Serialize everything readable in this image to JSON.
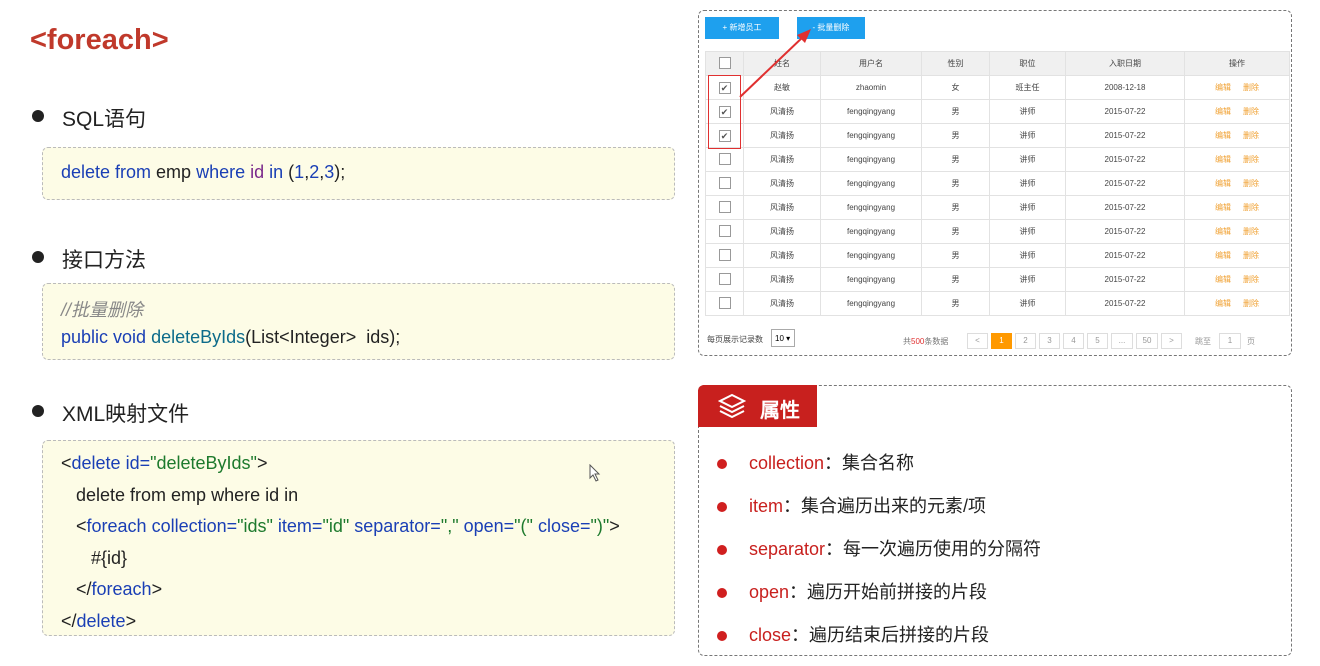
{
  "title": "<foreach>",
  "sections": [
    {
      "heading": "SQL语句",
      "lines": [
        [
          [
            "delete from",
            "kw"
          ],
          [
            " emp ",
            ""
          ],
          [
            "where",
            "kw"
          ],
          [
            " ",
            ""
          ],
          [
            "id",
            "pur"
          ],
          [
            " ",
            ""
          ],
          [
            "in",
            "kw"
          ],
          [
            " (",
            ""
          ],
          [
            "1",
            "num"
          ],
          [
            ",",
            ""
          ],
          [
            "2",
            "num"
          ],
          [
            ",",
            ""
          ],
          [
            "3",
            "num"
          ],
          [
            ");",
            ""
          ]
        ]
      ]
    },
    {
      "heading": "接口方法",
      "lines": [
        [
          [
            "//批量删除",
            "cmt"
          ]
        ],
        [
          [
            "public void",
            "kw"
          ],
          [
            " ",
            ""
          ],
          [
            "deleteByIds",
            "fn"
          ],
          [
            "(List<Integer>  ids);",
            ""
          ]
        ]
      ]
    },
    {
      "heading": "XML映射文件",
      "lines": [
        [
          [
            "<",
            ""
          ],
          [
            "delete",
            "kw"
          ],
          [
            " id=",
            "kw"
          ],
          [
            "\"deleteByIds\"",
            "str"
          ],
          [
            ">",
            ""
          ]
        ],
        [
          [
            "   delete from emp where id in",
            ""
          ]
        ],
        [
          [
            "   <",
            ""
          ],
          [
            "foreach",
            "kw"
          ],
          [
            " collection=",
            "kw"
          ],
          [
            "\"ids\"",
            "str"
          ],
          [
            " item=",
            "kw"
          ],
          [
            "\"id\"",
            "str"
          ],
          [
            " separator=",
            "kw"
          ],
          [
            "\",\"",
            "str"
          ],
          [
            " open=",
            "kw"
          ],
          [
            "\"(\"",
            "str"
          ],
          [
            " close=",
            "kw"
          ],
          [
            "\")\"",
            "str"
          ],
          [
            ">",
            ""
          ]
        ],
        [
          [
            "      #{id}",
            ""
          ]
        ],
        [
          [
            "   </",
            ""
          ],
          [
            "foreach",
            "kw"
          ],
          [
            ">",
            ""
          ]
        ],
        [
          [
            "</",
            ""
          ],
          [
            "delete",
            "kw"
          ],
          [
            ">",
            ""
          ]
        ]
      ]
    }
  ],
  "widget": {
    "add_button": "+ 新增员工",
    "batch_delete_button": "- 批量删除",
    "columns": [
      "姓名",
      "用户名",
      "性别",
      "职位",
      "入职日期",
      "操作"
    ],
    "rows": [
      {
        "checked": true,
        "name": "赵敏",
        "username": "zhaomin",
        "gender": "女",
        "position": "班主任",
        "date": "2008-12-18"
      },
      {
        "checked": true,
        "name": "风清扬",
        "username": "fengqingyang",
        "gender": "男",
        "position": "讲师",
        "date": "2015-07-22"
      },
      {
        "checked": true,
        "name": "风清扬",
        "username": "fengqingyang",
        "gender": "男",
        "position": "讲师",
        "date": "2015-07-22"
      },
      {
        "checked": false,
        "name": "风清扬",
        "username": "fengqingyang",
        "gender": "男",
        "position": "讲师",
        "date": "2015-07-22"
      },
      {
        "checked": false,
        "name": "风清扬",
        "username": "fengqingyang",
        "gender": "男",
        "position": "讲师",
        "date": "2015-07-22"
      },
      {
        "checked": false,
        "name": "风清扬",
        "username": "fengqingyang",
        "gender": "男",
        "position": "讲师",
        "date": "2015-07-22"
      },
      {
        "checked": false,
        "name": "风清扬",
        "username": "fengqingyang",
        "gender": "男",
        "position": "讲师",
        "date": "2015-07-22"
      },
      {
        "checked": false,
        "name": "风清扬",
        "username": "fengqingyang",
        "gender": "男",
        "position": "讲师",
        "date": "2015-07-22"
      },
      {
        "checked": false,
        "name": "风清扬",
        "username": "fengqingyang",
        "gender": "男",
        "position": "讲师",
        "date": "2015-07-22"
      },
      {
        "checked": false,
        "name": "风清扬",
        "username": "fengqingyang",
        "gender": "男",
        "position": "讲师",
        "date": "2015-07-22"
      }
    ],
    "edit_label": "编辑",
    "delete_label": "删除",
    "page_size_label": "每页展示记录数",
    "page_size": "10",
    "total_prefix": "共",
    "total": "500",
    "total_suffix": "条数据",
    "pages": [
      "<",
      "1",
      "2",
      "3",
      "4",
      "5",
      "...",
      "50",
      ">"
    ],
    "current_page": "1",
    "jump_label": "跳至",
    "jump_value": "1",
    "page_unit": "页"
  },
  "properties": {
    "heading": "属性",
    "items": [
      {
        "key": "collection",
        "desc": "：集合名称"
      },
      {
        "key": "item",
        "desc": "：集合遍历出来的元素/项"
      },
      {
        "key": "separator",
        "desc": "：每一次遍历使用的分隔符"
      },
      {
        "key": "open",
        "desc": "：遍历开始前拼接的片段"
      },
      {
        "key": "close",
        "desc": "：遍历结束后拼接的片段"
      }
    ]
  }
}
